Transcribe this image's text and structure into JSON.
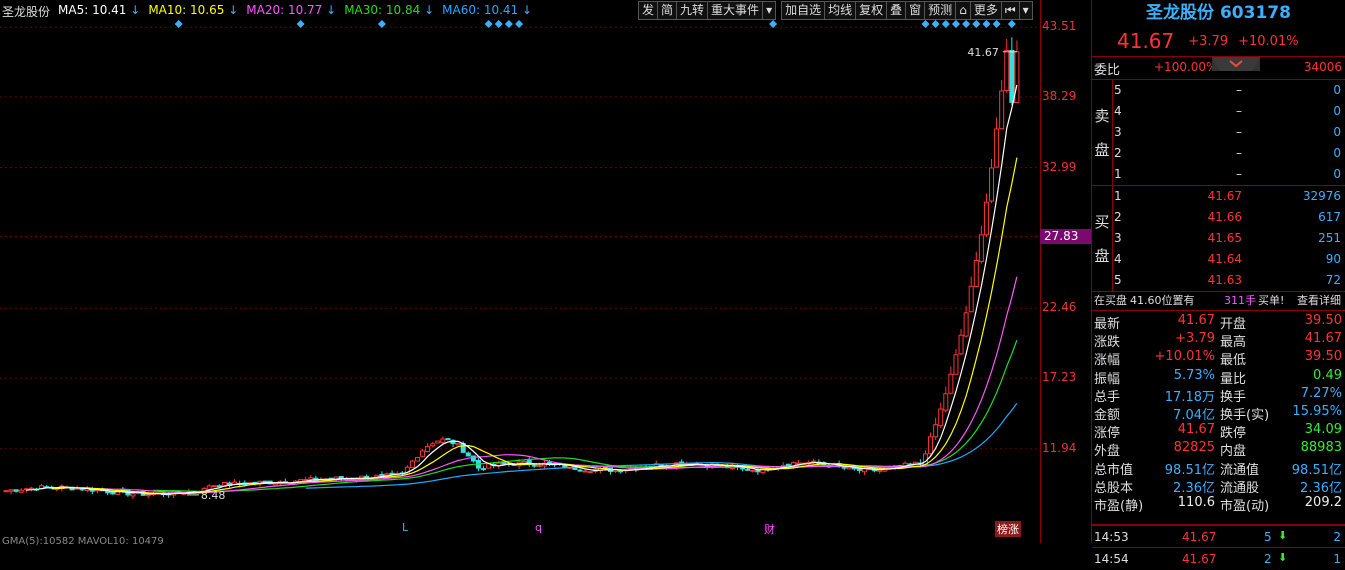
{
  "legend": {
    "stock": "圣龙股份",
    "ma5": "MA5: 10.41",
    "ma10": "MA10: 10.65",
    "ma20": "MA20: 10.77",
    "ma30": "MA30: 10.84",
    "ma60": "MA60: 10.41",
    "arrow": "↓"
  },
  "colors": {
    "ma5": "#ffffff",
    "ma10": "#ffff00",
    "ma20": "#ff55ff",
    "ma30": "#22dd22",
    "ma60": "#22aaff",
    "up": "#ff3333",
    "down": "#33e0e0",
    "axis": "#ee3333",
    "grid": "#6a0000",
    "blue": "#3ab0ff"
  },
  "toolbar": [
    "发",
    "简",
    "九转",
    "重大事件",
    "▾",
    "加自选",
    "均线",
    "复权",
    "叠",
    "窗",
    "预测",
    "⌂",
    "更多",
    "⏮",
    "▾"
  ],
  "chart_data": {
    "type": "candlestick",
    "y_ticks": [
      "43.51",
      "38.29",
      "32.99",
      "27.83",
      "22.46",
      "17.23",
      "11.94"
    ],
    "y_tick_values": [
      43.51,
      38.29,
      32.99,
      27.83,
      22.46,
      17.23,
      11.94
    ],
    "highlight_tick": "27.83",
    "ylim": [
      6.6,
      44.5
    ],
    "high_label": "41.67",
    "low_label": "8.48",
    "event_marks": [
      "L",
      "q",
      "财",
      "榜涨"
    ],
    "bottom_text": "GMA(5):10582  MAVOL10: 10479"
  },
  "panel": {
    "title": "圣龙股份 603178",
    "price": "41.67",
    "change": "+3.79",
    "pct": "+10.01%",
    "weibi_label": "委比",
    "weibi_pct": "+100.00%",
    "weibi_val": "34006",
    "sell_label": [
      "卖",
      "盘"
    ],
    "buy_label": [
      "买",
      "盘"
    ],
    "sells": [
      {
        "n": "5",
        "p": "–",
        "v": "0"
      },
      {
        "n": "4",
        "p": "–",
        "v": "0"
      },
      {
        "n": "3",
        "p": "–",
        "v": "0"
      },
      {
        "n": "2",
        "p": "–",
        "v": "0"
      },
      {
        "n": "1",
        "p": "–",
        "v": "0"
      }
    ],
    "buys": [
      {
        "n": "1",
        "p": "41.67",
        "v": "32976"
      },
      {
        "n": "2",
        "p": "41.66",
        "v": "617"
      },
      {
        "n": "3",
        "p": "41.65",
        "v": "251"
      },
      {
        "n": "4",
        "p": "41.64",
        "v": "90"
      },
      {
        "n": "5",
        "p": "41.63",
        "v": "72"
      }
    ],
    "notice_a": "在买盘",
    "notice_b": "41.60位置有",
    "notice_c": "311手",
    "notice_d": "买单!",
    "notice_link": "查看详细",
    "stats": [
      {
        "k": "最新",
        "v": "41.67",
        "c": "up",
        "k2": "开盘",
        "v2": "39.50",
        "c2": "up"
      },
      {
        "k": "涨跌",
        "v": "+3.79",
        "c": "up",
        "k2": "最高",
        "v2": "41.67",
        "c2": "up"
      },
      {
        "k": "涨幅",
        "v": "+10.01%",
        "c": "up",
        "k2": "最低",
        "v2": "39.50",
        "c2": "up"
      },
      {
        "k": "振幅",
        "v": "5.73%",
        "c": "blue",
        "k2": "量比",
        "v2": "0.49",
        "c2": "green"
      },
      {
        "k": "总手",
        "v": "17.18万",
        "c": "blue",
        "k2": "换手",
        "v2": "7.27%",
        "c2": "blue"
      },
      {
        "k": "金额",
        "v": "7.04亿",
        "c": "blue",
        "k2": "换手(实)",
        "v2": "15.95%",
        "c2": "blue"
      },
      {
        "k": "涨停",
        "v": "41.67",
        "c": "up",
        "k2": "跌停",
        "v2": "34.09",
        "c2": "green"
      },
      {
        "k": "外盘",
        "v": "82825",
        "c": "up",
        "k2": "内盘",
        "v2": "88983",
        "c2": "green"
      },
      {
        "k": "总市值",
        "v": "98.51亿",
        "c": "blue",
        "k2": "流通值",
        "v2": "98.51亿",
        "c2": "blue"
      },
      {
        "k": "总股本",
        "v": "2.36亿",
        "c": "blue",
        "k2": "流通股",
        "v2": "2.36亿",
        "c2": "blue"
      },
      {
        "k": "市盈(静)",
        "v": "110.6",
        "c": "white",
        "k2": "市盈(动)",
        "v2": "209.2",
        "c2": "white"
      }
    ],
    "ticks": [
      {
        "t": "14:53",
        "p": "41.67",
        "v": "5",
        "s": "2"
      },
      {
        "t": "14:54",
        "p": "41.67",
        "v": "2",
        "s": "1"
      }
    ]
  }
}
